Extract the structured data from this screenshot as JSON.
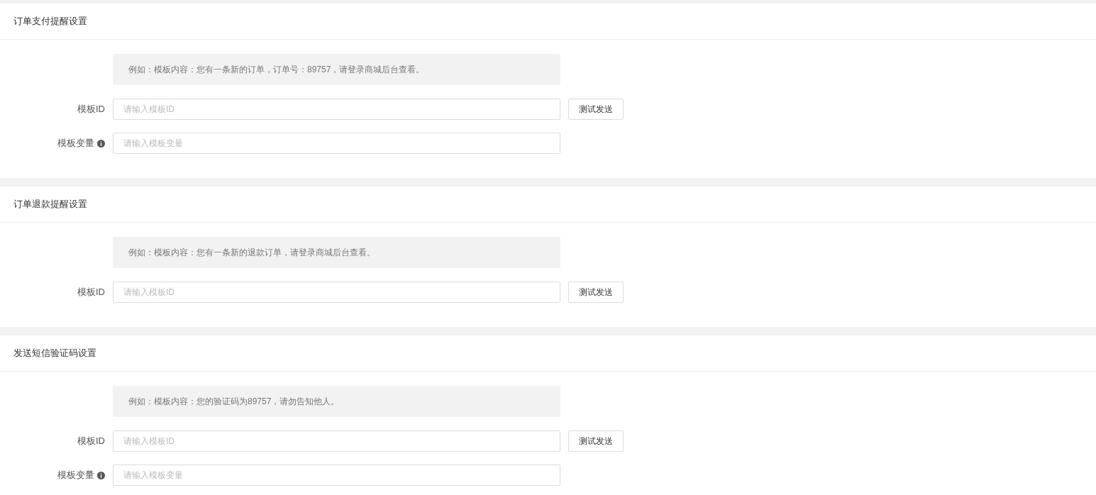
{
  "sections": [
    {
      "title": "订单支付提醒设置",
      "example": "例如：模板内容：您有一条新的订单，订单号：89757，请登录商城后台查看。",
      "rows": [
        {
          "label": "模板ID",
          "info": false,
          "placeholder": "请输入模板ID",
          "button": "测试发送"
        },
        {
          "label": "模板变量",
          "info": true,
          "placeholder": "请输入模板变量"
        }
      ]
    },
    {
      "title": "订单退款提醒设置",
      "example": "例如：模板内容：您有一条新的退款订单，请登录商城后台查看。",
      "rows": [
        {
          "label": "模板ID",
          "info": false,
          "placeholder": "请输入模板ID",
          "button": "测试发送"
        }
      ]
    },
    {
      "title": "发送短信验证码设置",
      "example": "例如：模板内容：您的验证码为89757，请勿告知他人。",
      "rows": [
        {
          "label": "模板ID",
          "info": false,
          "placeholder": "请输入模板ID",
          "button": "测试发送"
        },
        {
          "label": "模板变量",
          "info": true,
          "placeholder": "请输入模板变量"
        }
      ]
    }
  ]
}
